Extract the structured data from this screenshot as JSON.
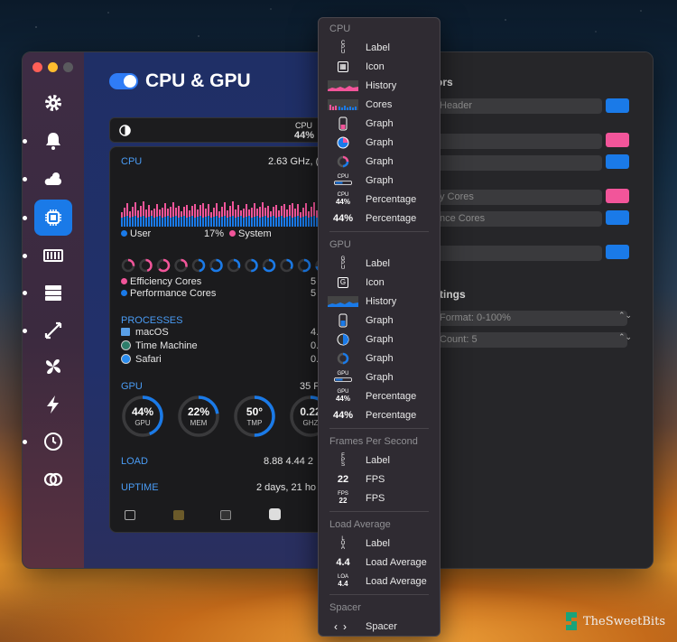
{
  "app": {
    "title": "CPU & GPU"
  },
  "sidebar_icons": [
    "gear-icon",
    "bell-icon",
    "cloud-sun-icon",
    "cpu-icon",
    "memory-icon",
    "disk-icon",
    "arrows-icon",
    "fan-icon",
    "bolt-icon",
    "clock-icon",
    "rings-icon"
  ],
  "colors": {
    "accent": "#1a7ae8",
    "pink": "#f2559a",
    "blue": "#1a7ae8"
  },
  "cpu_top": {
    "label": "CPU",
    "value": "44%"
  },
  "panel": {
    "cpu_label": "CPU",
    "cpu_freq": "2.63 GHz, (",
    "user_label": "User",
    "user_pct": "17%",
    "system_label": "System",
    "eff_cores": "Efficiency Cores",
    "eff_val": "5",
    "perf_cores": "Performance Cores",
    "perf_val": "5",
    "processes": "PROCESSES",
    "procs": [
      {
        "name": "macOS",
        "val": "4."
      },
      {
        "name": "Time Machine",
        "val": "0."
      },
      {
        "name": "Safari",
        "val": "0."
      }
    ],
    "gpu_label": "GPU",
    "gpu_val": "35 F",
    "gauges": [
      {
        "v": "44%",
        "l": "GPU"
      },
      {
        "v": "22%",
        "l": "MEM"
      },
      {
        "v": "50°",
        "l": "TMP"
      },
      {
        "v": "0.22",
        "l": "GHZ"
      }
    ],
    "load_label": "LOAD",
    "load_val": "8.88 4.44 2",
    "uptime_label": "UPTIME",
    "uptime_val": "2 days, 21 ho"
  },
  "right": {
    "h1": "ors",
    "f1": "Header",
    "f4": "y Cores",
    "f5": "nce Cores",
    "h2": "ttings",
    "f7": "Format: 0-100%",
    "f8": "Count: 5"
  },
  "menu": {
    "cpu": "CPU",
    "cpu_items": [
      "Label",
      "Icon",
      "History",
      "Cores",
      "Graph",
      "Graph",
      "Graph",
      "Graph",
      "Percentage",
      "Percentage"
    ],
    "gpu": "GPU",
    "gpu_items": [
      "Label",
      "Icon",
      "History",
      "Graph",
      "Graph",
      "Graph",
      "Graph",
      "Percentage",
      "Percentage"
    ],
    "fps": "Frames Per Second",
    "fps_items": [
      "Label",
      "FPS",
      "FPS"
    ],
    "load": "Load Average",
    "load_items": [
      "Label",
      "Load Average",
      "Load Average"
    ],
    "spacer": "Spacer",
    "spacer_items": [
      "Spacer"
    ],
    "icon_text": {
      "cpu_pct_small": "CPU",
      "pct44": "44%",
      "gpu_small": "GPU",
      "fps22": "22",
      "fps_small": "FPS",
      "load44": "4.4",
      "load_small": "LOA"
    }
  },
  "watermark": "TheSweetBits"
}
